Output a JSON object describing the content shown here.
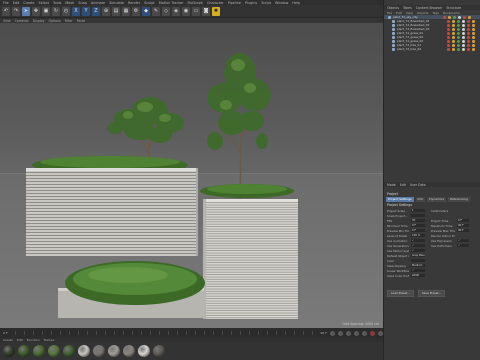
{
  "menubar": [
    "File",
    "Edit",
    "Create",
    "Select",
    "Tools",
    "Mesh",
    "Snap",
    "Animate",
    "Simulate",
    "Render",
    "Sculpt",
    "Motion Tracker",
    "MoGraph",
    "Character",
    "Pipeline",
    "Plugins",
    "Script",
    "Window",
    "Help"
  ],
  "viewport": {
    "menu": [
      "View",
      "Cameras",
      "Display",
      "Options",
      "Filter",
      "Panel"
    ],
    "status": "Grid Spacing: 1000 cm"
  },
  "timeline": {
    "start": "0 F",
    "end": "90 F"
  },
  "materials": {
    "menu": [
      "Create",
      "Edit",
      "Function",
      "Texture"
    ],
    "colors": [
      "#2f3a24",
      "#3d5c2a",
      "#4a6b30",
      "#56773a",
      "#3f5f2d",
      "#c9c6bf",
      "#7a7570",
      "#a19d95",
      "#8a857d",
      "#d8d6d0",
      "#5d5a55"
    ]
  },
  "object_manager": {
    "tabs": [
      "Objects",
      "Takes",
      "Content Browser",
      "Structure"
    ],
    "menu": [
      "File",
      "Edit",
      "View",
      "Objects",
      "Tags",
      "Bookmarks"
    ],
    "objects": [
      {
        "label": "plant_72_sky_city",
        "parent": true
      },
      {
        "label": "plant_72_flowerbed_01",
        "parent": false
      },
      {
        "label": "plant_72_flowerbed_02",
        "parent": false
      },
      {
        "label": "plant_72_flowerbed_03",
        "parent": false
      },
      {
        "label": "plant_72_grass_01",
        "parent": false
      },
      {
        "label": "plant_72_grass_02",
        "parent": false
      },
      {
        "label": "plant_72_grass_03",
        "parent": false
      },
      {
        "label": "plant_72_tree_01",
        "parent": false
      },
      {
        "label": "plant_72_tree_02",
        "parent": false
      }
    ]
  },
  "attributes": {
    "tabs_header": [
      "Mode",
      "Edit",
      "User Data"
    ],
    "title": "Project",
    "tabs": [
      "Project Settings",
      "Info",
      "Dynamics",
      "Referencing"
    ],
    "active_tab": "Project Settings",
    "section": "Project Settings",
    "fields": [
      {
        "k": "Project Scale",
        "v": "1",
        "k2": "Centimeters",
        "v2": ""
      },
      {
        "k": "Scale Project...",
        "v": "",
        "k2": "",
        "v2": ""
      },
      {
        "k": "FPS",
        "v": "30",
        "k2": "Project Time",
        "v2": "0 F"
      },
      {
        "k": "Minimum Time",
        "v": "0 F",
        "k2": "Maximum Time",
        "v2": "90 F"
      },
      {
        "k": "Preview Min Time",
        "v": "0 F",
        "k2": "Preview Max Time",
        "v2": "90 F"
      },
      {
        "k": "Level of Detail",
        "v": "100 %",
        "k2": "Render LOD in Editor",
        "v2": ""
      },
      {
        "k": "Use Animation",
        "v": "✓",
        "k2": "Use Expression",
        "v2": "✓"
      },
      {
        "k": "Use Generators",
        "v": "✓",
        "k2": "Use Deformers",
        "v2": "✓"
      },
      {
        "k": "Use Motion System",
        "v": "✓",
        "k2": "",
        "v2": ""
      },
      {
        "k": "Default Object Color",
        "v": "Gray Blue",
        "k2": "",
        "v2": ""
      },
      {
        "k": "Color",
        "v": "",
        "k2": "",
        "v2": ""
      },
      {
        "k": "View Clipping",
        "v": "Medium",
        "k2": "",
        "v2": ""
      },
      {
        "k": "Linear Workflow",
        "v": "✓",
        "k2": "",
        "v2": ""
      },
      {
        "k": "Input Color Profile",
        "v": "sRGB",
        "k2": "",
        "v2": ""
      }
    ],
    "buttons": [
      "Load Preset...",
      "Save Preset..."
    ]
  }
}
